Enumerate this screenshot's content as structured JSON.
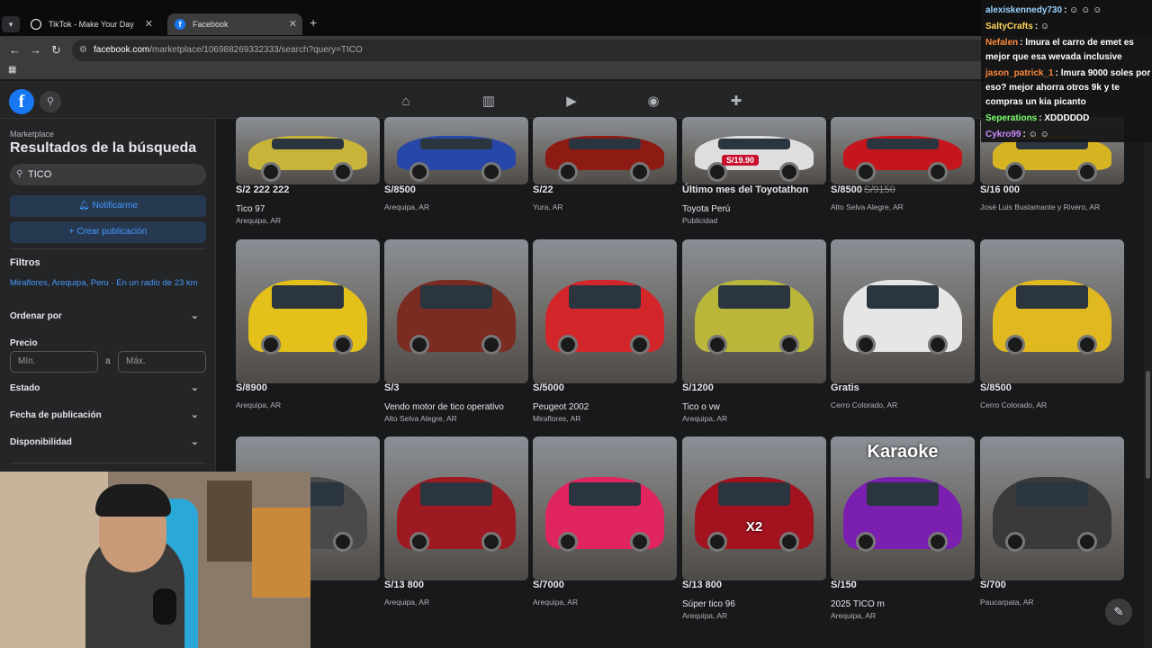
{
  "browser": {
    "tabs": [
      {
        "title": "TikTok - Make Your Day"
      },
      {
        "title": "Facebook"
      }
    ],
    "url_domain": "facebook.com",
    "url_path": "/marketplace/106988269332333/search?query=TICO",
    "new_tab": "+",
    "close": "✕",
    "back": "←",
    "forward": "→",
    "reload": "↻",
    "apps": "▦"
  },
  "fb": {
    "logo": "f"
  },
  "sidebar": {
    "label": "Marketplace",
    "title": "Resultados de la búsqueda",
    "search_value": "TICO",
    "notify_label": "Notificarme",
    "create_label": "Crear publicación",
    "filters_heading": "Filtros",
    "location": "Miraflores, Arequipa, Peru · En un radio de 23 km",
    "sort_label": "Ordenar por",
    "price_label": "Precio",
    "min_placeholder": "Mín.",
    "price_sep": "a",
    "max_placeholder": "Máx.",
    "state_label": "Estado",
    "date_label": "Fecha de publicación",
    "avail_label": "Disponibilidad"
  },
  "listings": [
    {
      "price": "S/2 222 222",
      "title": "Tico 97",
      "location": "Arequipa, AR",
      "color": "#c9b43a"
    },
    {
      "price": "S/8500",
      "title": "",
      "location": "Arequipa, AR",
      "color": "#2747a8"
    },
    {
      "price": "S/22",
      "title": "",
      "location": "Yura, AR",
      "color": "#8c1b14"
    },
    {
      "price": "Último mes del Toyotathon",
      "title": "Toyota Perú",
      "location": "Publicidad",
      "color": "#dedede"
    },
    {
      "price": "S/8500",
      "old_price": "S/9150",
      "title": "",
      "location": "Alto Selva Alegre, AR",
      "color": "#c4161c"
    },
    {
      "price": "S/16 000",
      "title": "",
      "location": "José Luis Bustamante y Rivero, AR",
      "color": "#d6b422"
    },
    {
      "price": "S/8900",
      "title": "",
      "location": "Arequipa, AR",
      "color": "#e3c11a"
    },
    {
      "price": "S/3",
      "title": "Vendo motor de tico operativo",
      "location": "Alto Selva Alegre, AR",
      "color": "#7a2b22"
    },
    {
      "price": "S/5000",
      "title": "Peugeot 2002",
      "location": "Miraflores, AR",
      "color": "#d2262a"
    },
    {
      "price": "S/1200",
      "title": "Tico o vw",
      "location": "Arequipa, AR",
      "color": "#b9b63a"
    },
    {
      "price": "Gratis",
      "title": "",
      "location": "Cerro Colorado, AR",
      "color": "#e6e6e6"
    },
    {
      "price": "S/8500",
      "title": "",
      "location": "Cerro Colorado, AR",
      "color": "#e0b820"
    },
    {
      "price": "",
      "title": "",
      "location": "",
      "color": "#4a4a4a"
    },
    {
      "price": "S/13 800",
      "title": "",
      "location": "Arequipa, AR",
      "color": "#9e1a22"
    },
    {
      "price": "S/7000",
      "title": "",
      "location": "Arequipa, AR",
      "color": "#e0245e"
    },
    {
      "price": "S/13 800",
      "title": "Súper tico 96",
      "location": "Arequipa, AR",
      "color": "#a3121f",
      "overlay": "X2"
    },
    {
      "price": "S/150",
      "title": "2025 TICO m",
      "location": "Arequipa, AR",
      "color": "#7a1fb0",
      "overlay": "Karaoke"
    },
    {
      "price": "S/700",
      "title": "",
      "location": "Paucarpata, AR",
      "color": "#3a3a3a"
    }
  ],
  "ad_price_tag": "S/19.90",
  "chat": [
    {
      "user": "alexiskennedy730",
      "text": ": ☺ ☺ ☺",
      "color": "#9bd4ff"
    },
    {
      "user": "SaltyCrafts",
      "text": ": ☺",
      "color": "#ffd65a"
    },
    {
      "user": "Nefalen",
      "text": ": lmura el carro de emet es mejor que esa wevada inclusive",
      "color": "#ff8a3d"
    },
    {
      "user": "jason_patrick_1",
      "text": ": lmura 9000 soles por eso? mejor ahorra otros 9k y te compras un kia picanto",
      "color": "#ff8a3d"
    },
    {
      "user": "Seperations",
      "text": ": XDDDDDD",
      "color": "#7cff6b"
    },
    {
      "user": "Cykro99",
      "text": ": ☺ ☺",
      "color": "#c98bff"
    }
  ]
}
